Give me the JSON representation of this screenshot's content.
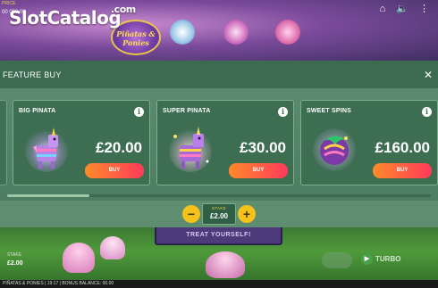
{
  "watermark": {
    "brand": "SlotCatalog",
    "suffix": ".com"
  },
  "background": {
    "top_left_label": "PRICE",
    "top_left_value": "00 000.00",
    "game_logo": "Piñatas & Ponies",
    "treat_button": "TREAT YOURSELF!",
    "stake_label": "STAKE",
    "stake_value": "£2.00",
    "turbo_label": "TURBO",
    "status_text": "PIÑATAS & PONIES | 19:17 | BONUS BALANCE: 00.00"
  },
  "top_icons": [
    {
      "name": "home-icon",
      "glyph": "⌂"
    },
    {
      "name": "sound-icon",
      "glyph": "🔈"
    },
    {
      "name": "menu-icon",
      "glyph": "⋮"
    }
  ],
  "feature_buy": {
    "title": "FEATURE BUY",
    "close_glyph": "✕",
    "cards": [
      {
        "title": "BIG PINATA",
        "price": "£20.00",
        "buy": "BUY",
        "info": "i",
        "art": "pinata-unicorn"
      },
      {
        "title": "SUPER PINATA",
        "price": "£30.00",
        "buy": "BUY",
        "info": "i",
        "art": "super-pinata-unicorn"
      },
      {
        "title": "SWEET SPINS",
        "price": "£160.00",
        "buy": "BUY",
        "info": "i",
        "art": "sweet-spins-logo"
      }
    ],
    "stake": {
      "label": "STAKE",
      "value": "£2.00",
      "minus": "−",
      "plus": "+"
    }
  },
  "colors": {
    "header": "#3c6b4f",
    "card_bg": "#3d6e52",
    "buy_gradient_start": "#ff8a2a",
    "buy_gradient_end": "#ff3a5a",
    "stake_buttons": "#f4c21a"
  }
}
